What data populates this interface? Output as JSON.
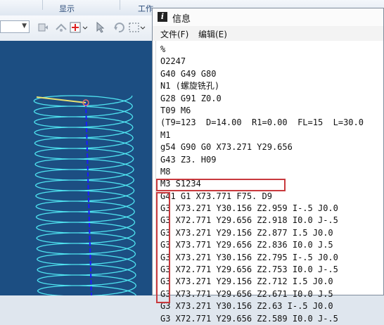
{
  "ribbon": {
    "display_label": "显示",
    "work_label": "工作"
  },
  "dialog": {
    "title": "信息",
    "title_icon": "info-icon",
    "menus": [
      "文件(F)",
      "编辑(E)"
    ],
    "lines": [
      "%",
      "O2247",
      "G40 G49 G80",
      "N1 (螺旋铣孔)",
      "G28 G91 Z0.0",
      "T09 M6",
      "(T9=123  D=14.00  R1=0.00  FL=15  L=30.0",
      "M1",
      "g54 G90 G0 X73.271 Y29.656",
      "G43 Z3. H09",
      "M8",
      "M3 S1234",
      "G41 G1 X73.771 F75. D9",
      "G3 X73.271 Y30.156 Z2.959 I-.5 J0.0",
      "G3 X72.771 Y29.656 Z2.918 I0.0 J-.5",
      "G3 X73.271 Y29.156 Z2.877 I.5 J0.0",
      "G3 X73.771 Y29.656 Z2.836 I0.0 J.5",
      "G3 X73.271 Y30.156 Z2.795 I-.5 J0.0",
      "G3 X72.771 Y29.656 Z2.753 I0.0 J-.5",
      "G3 X73.271 Y29.156 Z2.712 I.5 J0.0",
      "G3 X73.771 Y29.656 Z2.671 I0.0 J.5",
      "G3 X73.271 Y30.156 Z2.63 I-.5 J0.0",
      "G3 X72.771 Y29.656 Z2.589 I0.0 J-.5"
    ]
  },
  "highlight_color": "#c8393d",
  "viewport": {
    "background": "#1c4e82",
    "helix_color": "#4fe3f0",
    "axis_color": "#1b1bff",
    "lead_in_color": "#e8e070"
  }
}
